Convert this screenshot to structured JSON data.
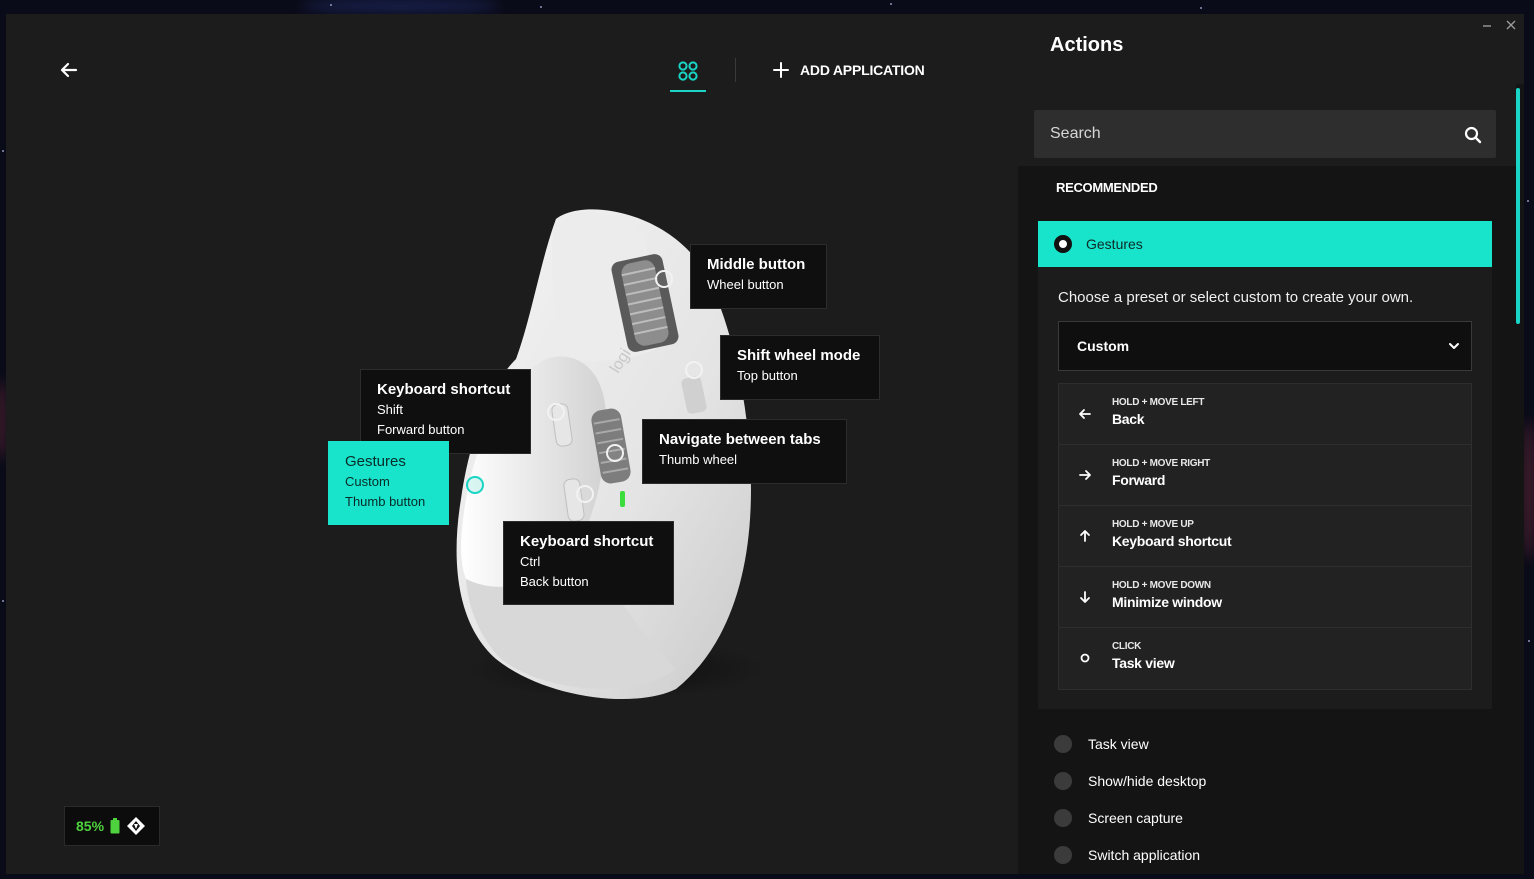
{
  "window": {
    "minimize_icon": "minimize-icon",
    "close_icon": "close-icon"
  },
  "toolbar": {
    "back_icon": "arrow-left-icon",
    "apps_icon": "apps-grid-icon",
    "add_application_label": "ADD APPLICATION"
  },
  "callouts": {
    "middle": {
      "title": "Middle button",
      "sub": "Wheel button"
    },
    "shift_wheel": {
      "title": "Shift wheel mode",
      "sub": "Top button"
    },
    "keyboard_fwd": {
      "title": "Keyboard shortcut",
      "line2": "Shift",
      "sub": "Forward button"
    },
    "navigate_tabs": {
      "title": "Navigate between tabs",
      "sub": "Thumb wheel"
    },
    "gestures": {
      "title": "Gestures",
      "line2": "Custom",
      "sub": "Thumb button"
    },
    "keyboard_back": {
      "title": "Keyboard shortcut",
      "line2": "Ctrl",
      "sub": "Back button"
    }
  },
  "device": {
    "brand_mark": "logi"
  },
  "battery": {
    "percent": "85%",
    "color": "#4ed23e"
  },
  "panel": {
    "title": "Actions",
    "search_placeholder": "Search",
    "recommended_label": "RECOMMENDED",
    "selected": {
      "label": "Gestures",
      "description": "Choose a preset or select custom to create your own.",
      "preset": "Custom",
      "items": [
        {
          "caption": "HOLD + MOVE LEFT",
          "action": "Back",
          "icon": "arrow-left-icon"
        },
        {
          "caption": "HOLD + MOVE RIGHT",
          "action": "Forward",
          "icon": "arrow-right-icon"
        },
        {
          "caption": "HOLD + MOVE UP",
          "action": "Keyboard shortcut",
          "icon": "arrow-up-icon"
        },
        {
          "caption": "HOLD + MOVE DOWN",
          "action": "Minimize window",
          "icon": "arrow-down-icon"
        },
        {
          "caption": "CLICK",
          "action": "Task view",
          "icon": "click-circle-icon"
        }
      ]
    },
    "others": [
      "Task view",
      "Show/hide desktop",
      "Screen capture",
      "Switch application"
    ]
  },
  "colors": {
    "accent": "#18e4cc",
    "background": "#1c1c1c",
    "panel": "#141414"
  }
}
